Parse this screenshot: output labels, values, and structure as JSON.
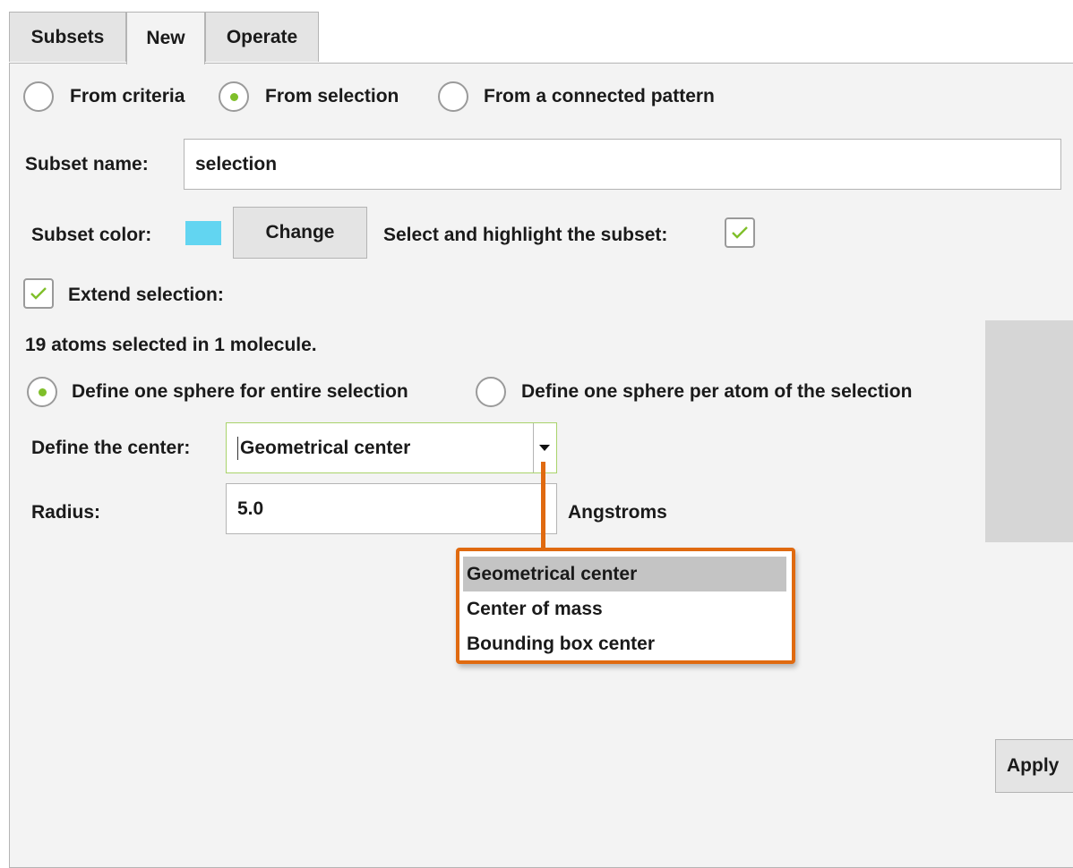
{
  "tabs": [
    {
      "label": "Subsets",
      "active": false
    },
    {
      "label": "New",
      "active": true
    },
    {
      "label": "Operate",
      "active": false
    }
  ],
  "source": {
    "options": [
      {
        "label": "From criteria",
        "checked": false
      },
      {
        "label": "From selection",
        "checked": true
      },
      {
        "label": "From a connected pattern",
        "checked": false
      }
    ]
  },
  "subset_name": {
    "label": "Subset name:",
    "value": "selection"
  },
  "subset_color": {
    "label": "Subset color:",
    "swatch": "#62d5f1",
    "change_label": "Change"
  },
  "highlight": {
    "label": "Select and highlight the subset:",
    "checked": true
  },
  "extend": {
    "label": "Extend selection:",
    "checked": true
  },
  "summary": "19 atoms selected in 1 molecule.",
  "sphere": {
    "options": [
      {
        "label": "Define one sphere for entire selection",
        "checked": true
      },
      {
        "label": "Define one sphere per atom of the selection",
        "checked": false
      }
    ]
  },
  "center": {
    "label": "Define the center:",
    "value": "Geometrical center",
    "options": [
      "Geometrical center",
      "Center of mass",
      "Bounding box center"
    ],
    "highlighted_index": 0
  },
  "radius": {
    "label": "Radius:",
    "value": "5.0",
    "unit": "Angstroms"
  },
  "apply_label": "Apply",
  "colors": {
    "accent": "#7fbf2a",
    "callout": "#e06a10",
    "background": "#f3f3f3"
  },
  "icons": {
    "check": "check-icon",
    "dropdown": "chevron-down-icon"
  }
}
